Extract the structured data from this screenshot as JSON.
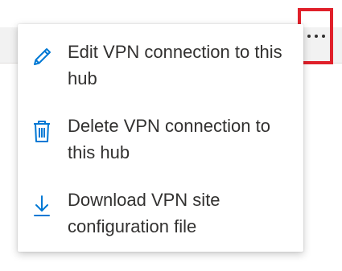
{
  "menu": {
    "items": [
      {
        "label": "Edit VPN connection to this hub",
        "icon": "pencil-icon"
      },
      {
        "label": "Delete VPN connection to this hub",
        "icon": "trash-icon"
      },
      {
        "label": "Download VPN site configuration file",
        "icon": "download-icon"
      }
    ]
  },
  "more_button": {
    "icon": "ellipsis-icon",
    "highlight_color": "#e0202a"
  },
  "colors": {
    "accent": "#0078d4",
    "text": "#323130"
  }
}
